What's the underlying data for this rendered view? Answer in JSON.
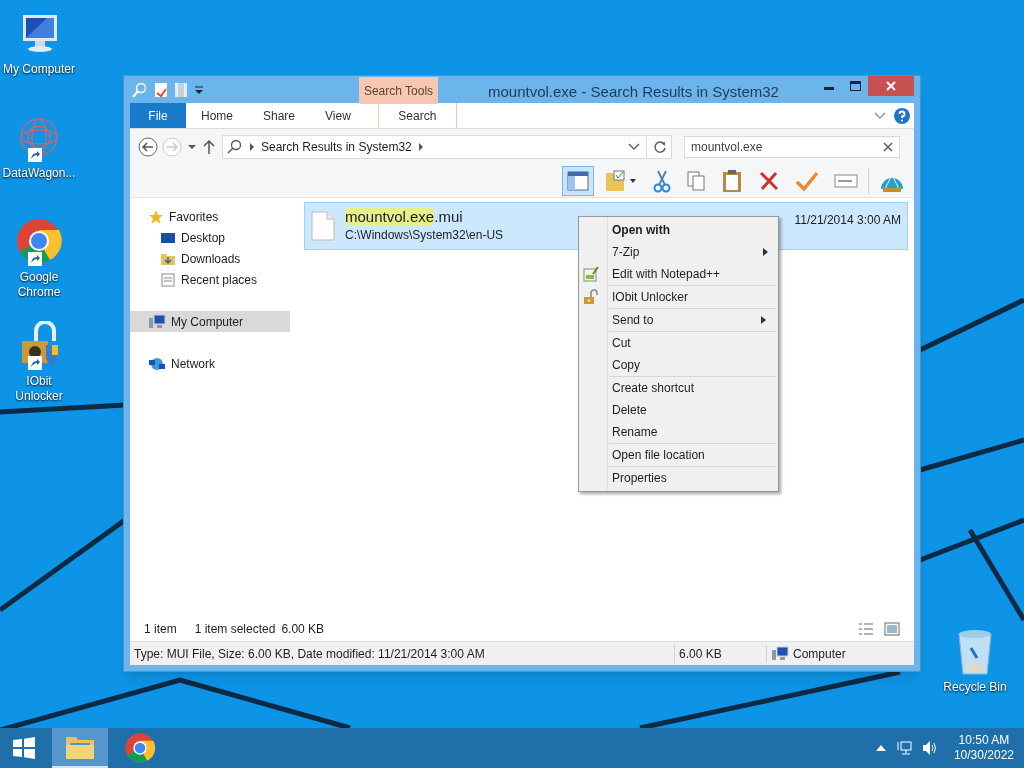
{
  "desktop_icons": [
    {
      "label": "My Computer",
      "kind": "computer",
      "shortcut": false
    },
    {
      "label": "DataWagon...",
      "kind": "datawagon",
      "shortcut": true
    },
    {
      "label": "Google Chrome",
      "kind": "chrome",
      "shortcut": true
    },
    {
      "label": "IObit Unlocker",
      "kind": "unlocker",
      "shortcut": true
    }
  ],
  "recycle_bin": {
    "label": "Recycle Bin"
  },
  "window": {
    "title": "mountvol.exe - Search Results in System32",
    "context_group": "Search Tools",
    "ribbon_tabs": [
      {
        "label": "File",
        "kind": "file"
      },
      {
        "label": "Home",
        "kind": "normal"
      },
      {
        "label": "Share",
        "kind": "normal"
      },
      {
        "label": "View",
        "kind": "normal"
      },
      {
        "label": "Search",
        "kind": "contextual"
      }
    ],
    "address": {
      "crumbs": [
        "Search Results in System32"
      ]
    },
    "search": {
      "value": "mountvol.exe"
    },
    "toolbar": [
      {
        "kind": "preview",
        "pressed": true
      },
      {
        "kind": "folder",
        "pressed": false
      },
      {
        "kind": "cut",
        "pressed": false
      },
      {
        "kind": "copy",
        "pressed": false
      },
      {
        "kind": "paste",
        "pressed": false
      },
      {
        "kind": "delete",
        "pressed": false
      },
      {
        "kind": "check",
        "pressed": false
      },
      {
        "kind": "rename",
        "pressed": false
      },
      {
        "kind": "shell",
        "pressed": false
      }
    ],
    "nav": [
      {
        "label": "Favorites",
        "kind": "favorites",
        "selected": false,
        "children": [
          {
            "label": "Desktop",
            "kind": "desktop",
            "selected": false
          },
          {
            "label": "Downloads",
            "kind": "downloads",
            "selected": false
          },
          {
            "label": "Recent places",
            "kind": "recent",
            "selected": false
          }
        ]
      },
      {
        "label": "My Computer",
        "kind": "computer",
        "selected": true
      },
      {
        "label": "Network",
        "kind": "network",
        "selected": false
      }
    ],
    "files": [
      {
        "name": [
          {
            "text": "mountvol.exe",
            "highlighted": true
          },
          {
            "text": ".mui",
            "highlighted": false
          }
        ],
        "path": "C:\\Windows\\System32\\en-US",
        "date": "11/21/2014 3:00 AM",
        "selected": true
      }
    ],
    "status": {
      "count": "1 item",
      "selection": "1 item selected",
      "size": "6.00 KB"
    },
    "details_bar": {
      "info": "Type: MUI File, Size: 6.00 KB, Date modified: 11/21/2014 3:00 AM",
      "size": "6.00 KB",
      "location": "Computer"
    }
  },
  "context_menu": [
    [
      {
        "label": "Open with",
        "bold": true,
        "submenu": false
      },
      {
        "label": "7-Zip",
        "bold": false,
        "submenu": true
      },
      {
        "label": "Edit with Notepad++",
        "bold": false,
        "submenu": false,
        "kind": "notepad"
      }
    ],
    [
      {
        "label": "IObit Unlocker",
        "bold": false,
        "submenu": false,
        "kind": "unlocker"
      }
    ],
    [
      {
        "label": "Send to",
        "bold": false,
        "submenu": true
      }
    ],
    [
      {
        "label": "Cut",
        "bold": false,
        "submenu": false
      },
      {
        "label": "Copy",
        "bold": false,
        "submenu": false
      }
    ],
    [
      {
        "label": "Create shortcut",
        "bold": false,
        "submenu": false
      },
      {
        "label": "Delete",
        "bold": false,
        "submenu": false
      },
      {
        "label": "Rename",
        "bold": false,
        "submenu": false
      }
    ],
    [
      {
        "label": "Open file location",
        "bold": false,
        "submenu": false
      }
    ],
    [
      {
        "label": "Properties",
        "bold": false,
        "submenu": false
      }
    ]
  ],
  "taskbar": {
    "apps": [
      {
        "kind": "explorer",
        "active": true
      },
      {
        "kind": "chrome",
        "active": false
      }
    ],
    "time": "10:50 AM",
    "date": "10/30/2022"
  }
}
